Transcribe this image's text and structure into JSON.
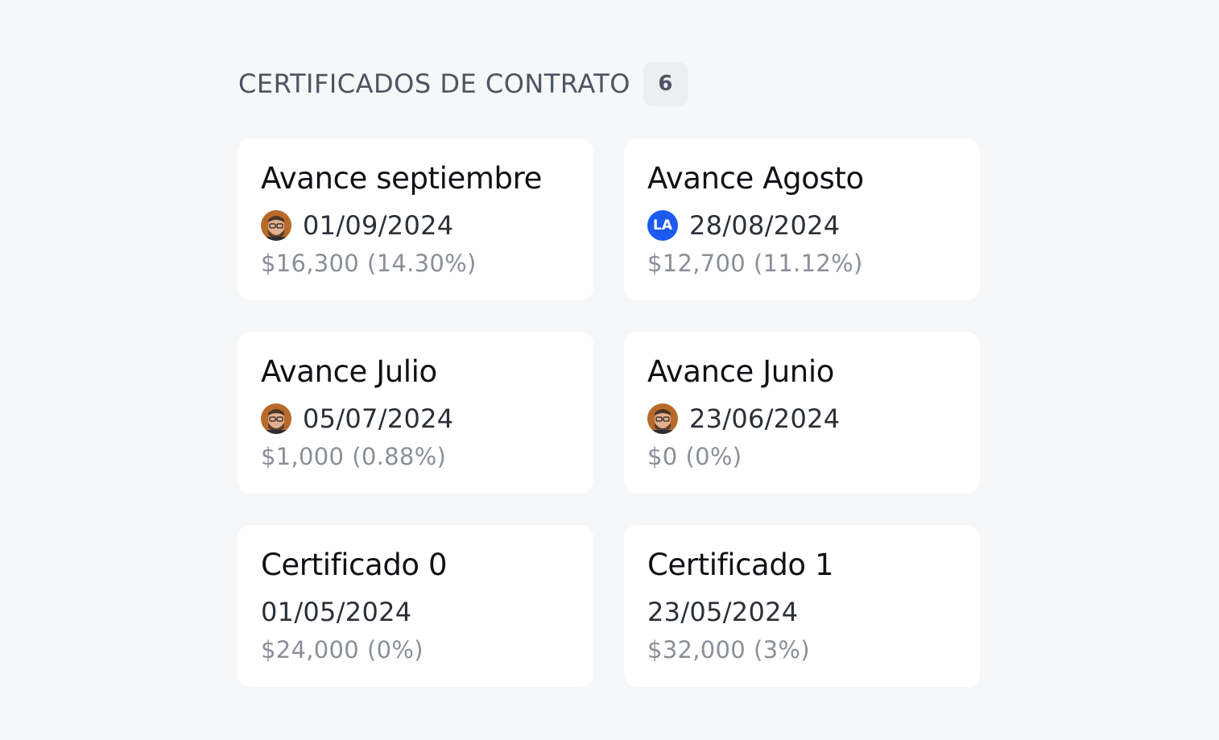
{
  "header": {
    "title": "CERTIFICADOS DE CONTRATO",
    "count": "6"
  },
  "cards": [
    {
      "title": "Avance septiembre",
      "avatar": {
        "type": "photo",
        "icon": "user-photo-avatar"
      },
      "date": "01/09/2024",
      "amount": "$16,300",
      "percent": "(14.30%)"
    },
    {
      "title": "Avance Agosto",
      "avatar": {
        "type": "initials",
        "initials": "LA",
        "color": "#1d5bf0"
      },
      "date": "28/08/2024",
      "amount": "$12,700",
      "percent": "(11.12%)"
    },
    {
      "title": "Avance Julio",
      "avatar": {
        "type": "photo",
        "icon": "user-photo-avatar"
      },
      "date": "05/07/2024",
      "amount": "$1,000",
      "percent": "(0.88%)"
    },
    {
      "title": "Avance Junio",
      "avatar": {
        "type": "photo",
        "icon": "user-photo-avatar"
      },
      "date": "23/06/2024",
      "amount": "$0",
      "percent": "(0%)"
    },
    {
      "title": "Certificado 0",
      "avatar": null,
      "date": "01/05/2024",
      "amount": "$24,000",
      "percent": "(0%)"
    },
    {
      "title": "Certificado 1",
      "avatar": null,
      "date": "23/05/2024",
      "amount": "$32,000",
      "percent": "(3%)"
    }
  ],
  "colors": {
    "background": "#f6f7f8",
    "card": "#ffffff",
    "title": "#0f1115",
    "date": "#2b3038",
    "muted": "#8a8f99",
    "badge_bg": "#eceef1",
    "initials_avatar": "#1d5bf0"
  }
}
